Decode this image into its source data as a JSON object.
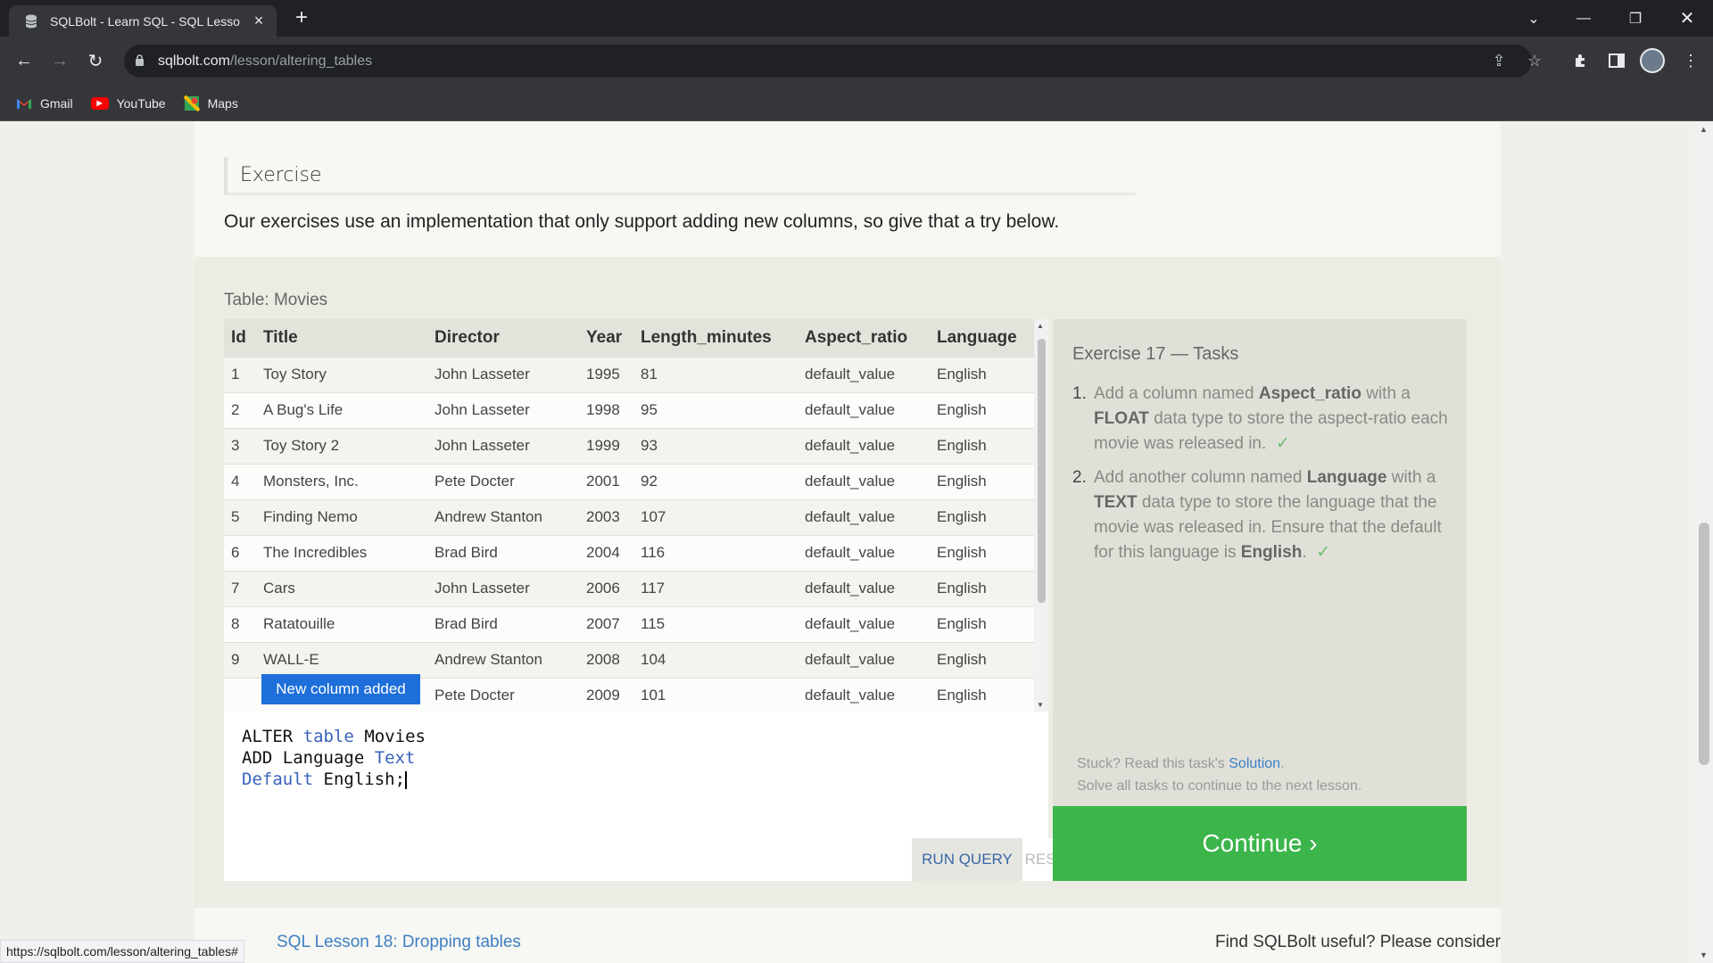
{
  "browser": {
    "tab_title": "SQLBolt - Learn SQL - SQL Lesso",
    "url_host": "sqlbolt.com",
    "url_path": "/lesson/altering_tables",
    "bookmarks": [
      "Gmail",
      "YouTube",
      "Maps"
    ],
    "status_url": "https://sqlbolt.com/lesson/altering_tables#"
  },
  "page": {
    "exercise_heading": "Exercise",
    "exercise_desc": "Our exercises use an implementation that only support adding new columns, so give that a try below.",
    "table_caption": "Table: Movies",
    "table": {
      "headers": [
        "Id",
        "Title",
        "Director",
        "Year",
        "Length_minutes",
        "Aspect_ratio",
        "Language"
      ],
      "rows": [
        [
          "1",
          "Toy Story",
          "John Lasseter",
          "1995",
          "81",
          "default_value",
          "English"
        ],
        [
          "2",
          "A Bug's Life",
          "John Lasseter",
          "1998",
          "95",
          "default_value",
          "English"
        ],
        [
          "3",
          "Toy Story 2",
          "John Lasseter",
          "1999",
          "93",
          "default_value",
          "English"
        ],
        [
          "4",
          "Monsters, Inc.",
          "Pete Docter",
          "2001",
          "92",
          "default_value",
          "English"
        ],
        [
          "5",
          "Finding Nemo",
          "Andrew Stanton",
          "2003",
          "107",
          "default_value",
          "English"
        ],
        [
          "6",
          "The Incredibles",
          "Brad Bird",
          "2004",
          "116",
          "default_value",
          "English"
        ],
        [
          "7",
          "Cars",
          "John Lasseter",
          "2006",
          "117",
          "default_value",
          "English"
        ],
        [
          "8",
          "Ratatouille",
          "Brad Bird",
          "2007",
          "115",
          "default_value",
          "English"
        ],
        [
          "9",
          "WALL-E",
          "Andrew Stanton",
          "2008",
          "104",
          "default_value",
          "English"
        ],
        [
          "",
          "",
          "Pete Docter",
          "2009",
          "101",
          "default_value",
          "English"
        ]
      ]
    },
    "toast": "New column added",
    "code": {
      "l1a": "ALTER",
      "l1b": "table",
      "l1c": "Movies",
      "l2a": "ADD Language",
      "l2b": "Text",
      "l3a": "Default",
      "l3b": "English;"
    },
    "run_label": "RUN QUERY",
    "reset_label": "RESET",
    "tasks": {
      "title": "Exercise 17 — Tasks",
      "items": [
        {
          "n": "1.",
          "t1": "Add a column named ",
          "b1": "Aspect_ratio",
          "t2": " with a ",
          "b2": "FLOAT",
          "t3": " data type to store the aspect-ratio each movie was released in.",
          "check": "✓"
        },
        {
          "n": "2.",
          "t1": "Add another column named ",
          "b1": "Language",
          "t2": " with a ",
          "b2": "TEXT",
          "t3": " data type to store the language that the movie was released in. Ensure that the default for this language is ",
          "b3": "English",
          "t4": ".",
          "check": "✓"
        }
      ],
      "stuck_prefix": "Stuck? Read this task's ",
      "stuck_link": "Solution",
      "stuck_suffix": ".",
      "solve_all": "Solve all tasks to continue to the next lesson.",
      "continue": "Continue ›"
    },
    "footer_next": "SQL Lesson 18: Dropping tables",
    "footer_right": "Find SQLBolt useful? Please consider"
  }
}
